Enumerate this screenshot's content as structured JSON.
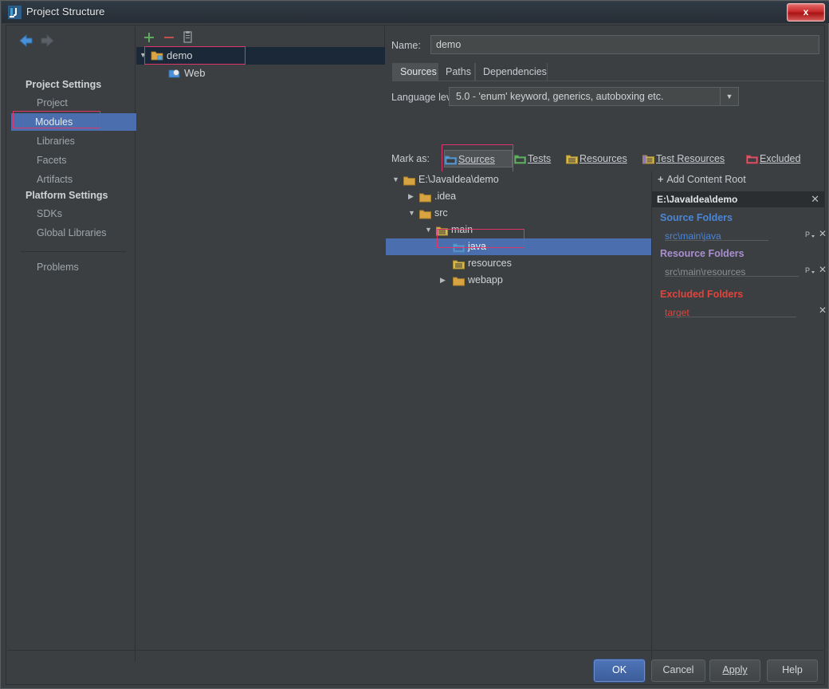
{
  "window": {
    "title": "Project Structure",
    "icon": "intellij-idea-icon",
    "close_label": "x"
  },
  "sidebar": {
    "back_icon": "back-arrow-icon",
    "forward_icon": "forward-arrow-icon",
    "sections": [
      {
        "title": "Project Settings",
        "items": [
          {
            "label": "Project",
            "selected": false
          },
          {
            "label": "Modules",
            "selected": true
          },
          {
            "label": "Libraries",
            "selected": false
          },
          {
            "label": "Facets",
            "selected": false
          },
          {
            "label": "Artifacts",
            "selected": false
          }
        ]
      },
      {
        "title": "Platform Settings",
        "items": [
          {
            "label": "SDKs",
            "selected": false
          },
          {
            "label": "Global Libraries",
            "selected": false
          }
        ]
      }
    ],
    "problems": {
      "label": "Problems"
    }
  },
  "modules_panel": {
    "toolbar": [
      {
        "name": "add-module-button",
        "glyph": "+"
      },
      {
        "name": "remove-module-button",
        "glyph": "-"
      },
      {
        "name": "copy-module-button",
        "glyph": "copy-icon"
      }
    ],
    "tree": [
      {
        "label": "demo",
        "icon": "module-folder-icon",
        "selected": true,
        "expanded": true,
        "depth": 0
      },
      {
        "label": "Web",
        "icon": "web-facet-icon",
        "selected": false,
        "depth": 1
      }
    ]
  },
  "details": {
    "name_label": "Name:",
    "name_value": "demo",
    "tabs": [
      {
        "label": "Sources",
        "active": true
      },
      {
        "label": "Paths",
        "active": false
      },
      {
        "label": "Dependencies",
        "active": false
      }
    ],
    "language_level_label": "Language level:",
    "language_level_value": "5.0 - 'enum' keyword, generics, autoboxing etc.",
    "mark_as_label": "Mark as:",
    "mark_as_buttons": [
      {
        "label": "Sources",
        "icon": "sources-folder-icon",
        "color": "#5b9bd5",
        "pressed": true
      },
      {
        "label": "Tests",
        "icon": "tests-folder-icon",
        "color": "#63b463",
        "pressed": false
      },
      {
        "label": "Resources",
        "icon": "resources-folder-icon",
        "color": "#d8b84a",
        "pressed": false
      },
      {
        "label": "Test Resources",
        "icon": "test-resources-folder-icon",
        "color": "#d8b84a",
        "pressed": false
      },
      {
        "label": "Excluded",
        "icon": "excluded-folder-icon",
        "color": "#e0566a",
        "pressed": false
      }
    ],
    "folder_tree": [
      {
        "label": "E:\\JavaIdea\\demo",
        "depth": 0,
        "twist": "down",
        "icon": "folder-icon",
        "color": "#d2d6d9",
        "selected": false
      },
      {
        "label": ".idea",
        "depth": 1,
        "twist": "right",
        "icon": "folder-icon",
        "color": "#d2d6d9",
        "selected": false
      },
      {
        "label": "src",
        "depth": 1,
        "twist": "down",
        "icon": "folder-icon",
        "color": "#d2d6d9",
        "selected": false
      },
      {
        "label": "main",
        "depth": 2,
        "twist": "down",
        "icon": "resources-folder-icon",
        "color": "#d2d6d9",
        "selected": false
      },
      {
        "label": "java",
        "depth": 3,
        "twist": "none",
        "icon": "sources-folder-icon",
        "color": "#eef1f4",
        "selected": true
      },
      {
        "label": "resources",
        "depth": 3,
        "twist": "none",
        "icon": "resources-folder-icon",
        "color": "#d2d6d9",
        "selected": false
      },
      {
        "label": "webapp",
        "depth": 2,
        "twist": "right",
        "icon": "folder-icon",
        "color": "#d2d6d9",
        "selected": false
      }
    ]
  },
  "content_roots": {
    "add_label": "Add Content Root",
    "add_icon": "plus-icon",
    "root_path": "E:\\JavaIdea\\demo",
    "remove_icon": "close-icon",
    "groups": [
      {
        "title": "Source Folders",
        "title_color": "#4a86d8",
        "rows": [
          {
            "path": "src\\main\\java",
            "color": "#4a86d8",
            "has_package_prefix": true
          }
        ]
      },
      {
        "title": "Resource Folders",
        "title_color": "#a98fd0",
        "rows": [
          {
            "path": "src\\main\\resources",
            "color": "#8b8f93",
            "has_package_prefix": true
          }
        ]
      },
      {
        "title": "Excluded Folders",
        "title_color": "#e0443c",
        "rows": [
          {
            "path": "target",
            "color": "#e0443c",
            "has_package_prefix": false
          }
        ]
      }
    ]
  },
  "footer": {
    "buttons": [
      {
        "label": "OK",
        "primary": true,
        "mnemonic": ""
      },
      {
        "label": "Cancel",
        "primary": false,
        "mnemonic": ""
      },
      {
        "label": "Apply",
        "primary": false,
        "mnemonic": "A"
      },
      {
        "label": "Help",
        "primary": false,
        "mnemonic": ""
      }
    ]
  },
  "colors": {
    "window_bg": "#3c3f41",
    "selection_blue": "#4b6eaf",
    "annotation_red": "#e0356a",
    "title_bg": "#2b333c"
  }
}
